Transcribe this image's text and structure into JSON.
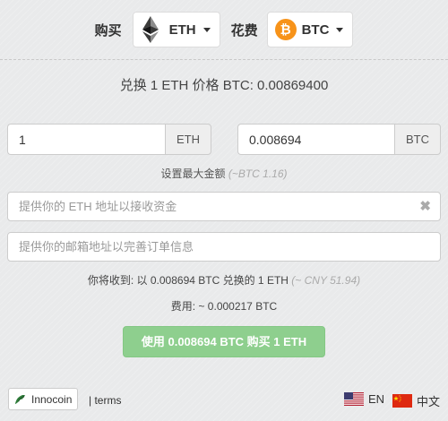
{
  "header": {
    "buy_label": "购买",
    "buy_coin": "ETH",
    "buy_coin_icon": "ethereum-icon",
    "spend_label": "花费",
    "spend_coin": "BTC",
    "spend_coin_icon": "bitcoin-icon"
  },
  "rate_text": "兑换 1 ETH 价格 BTC: 0.00869400",
  "amount_buy": {
    "value": "1",
    "unit": "ETH"
  },
  "amount_spend": {
    "value": "0.008694",
    "unit": "BTC"
  },
  "max_amount": {
    "label": "设置最大金额",
    "hint": "(~BTC 1.16)"
  },
  "eth_address": {
    "placeholder": "提供你的 ETH 地址以接收资金",
    "value": ""
  },
  "email": {
    "placeholder": "提供你的邮箱地址以完善订单信息",
    "value": ""
  },
  "summary": {
    "receive_text": "你将收到: 以 0.008694 BTC 兑换的 1 ETH",
    "receive_hint": "(~ CNY 51.94)",
    "fee_text": "费用: ~ 0.000217 BTC"
  },
  "buy_button": "使用 0.008694 BTC 购买 1 ETH",
  "footer": {
    "brand": "Innocoin",
    "terms": "| terms",
    "lang_en": "EN",
    "lang_zh": "中文"
  },
  "colors": {
    "bitcoin_orange": "#f7931a",
    "buy_button_green": "#8ecf8e"
  }
}
